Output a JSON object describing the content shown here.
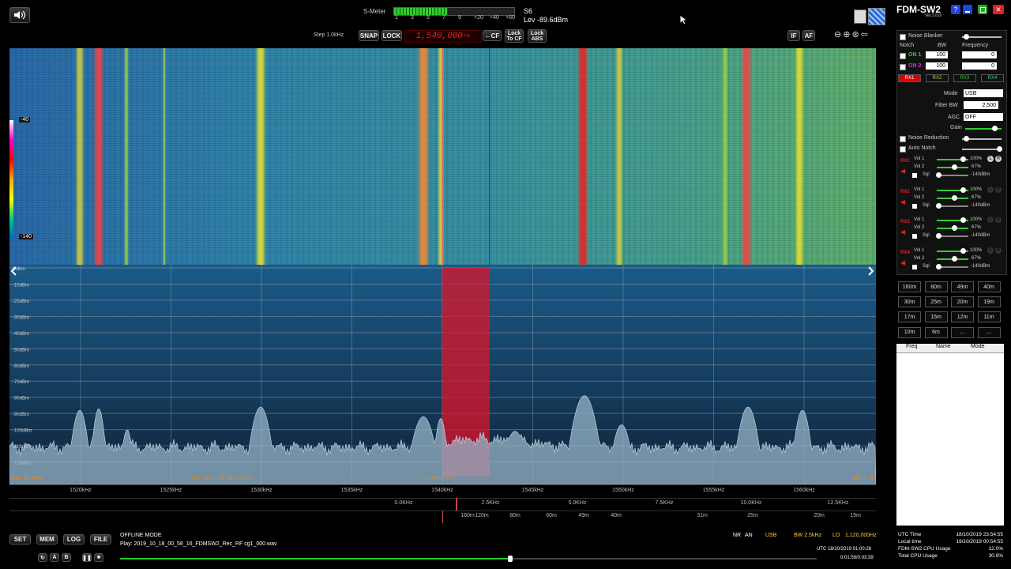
{
  "smeter": {
    "label": "S-Meter",
    "scale": [
      "1",
      "3",
      "5",
      "7",
      "9",
      "+20",
      "+40",
      "+60"
    ],
    "value": "S6",
    "level": "Lev -89.6dBm",
    "fill_fraction": 0.45
  },
  "toolbar": {
    "step": "Step 1.0kHz",
    "snap": "SNAP",
    "lock": "LOCK",
    "frequency": "1,540,000",
    "freq_unit": "Hz",
    "cf": "CF",
    "lock_to_cf": [
      "Lock",
      "To CF"
    ],
    "lock_abs": [
      "Lock",
      "ABS"
    ],
    "if": "IF",
    "af": "AF"
  },
  "waterfall": {
    "level_top": "-40",
    "level_bottom": "-140"
  },
  "spectrum": {
    "db_labels": [
      "0dBm",
      "-10dBm",
      "-20dBm",
      "-30dBm",
      "-40dBm",
      "-50dBm",
      "-60dBm",
      "-70dBm",
      "-80dBm",
      "-90dBm",
      "-100dBm",
      "-110dBm",
      "-120dBm"
    ],
    "span": "Span 48.0kHz",
    "fft_res": "FFT Res. 93.8Hz/point",
    "div": "5.0kHz/div",
    "avg": "AVG = 8",
    "freq_ticks": [
      "1520kHz",
      "1525kHz",
      "1530kHz",
      "1535kHz",
      "1540kHz",
      "1545kHz",
      "1550kHz",
      "1555kHz",
      "1560kHz"
    ],
    "if_ticks": [
      "0.0KHz",
      "2.5KHz",
      "5.0KHz",
      "7.5KHz",
      "10.0KHz",
      "12.5KHz"
    ],
    "meter_ticks": [
      "160m",
      "120m",
      "80m",
      "60m",
      "49m",
      "40m",
      "31m",
      "25m",
      "20m",
      "19m"
    ]
  },
  "status": {
    "set": "SET",
    "mem": "MEM",
    "log": "LOG",
    "file": "FILE",
    "mode_line": "OFFLINE MODE",
    "play_line": "Play: 2019_10_18_00_58_16_FDMSW2_Rec_RF cg1_000.wav",
    "nr": "NR",
    "an": "AN",
    "mode": "USB",
    "bw": "BW 2.5kHz",
    "lo": "LO",
    "lo_freq": "1,120,000Hz",
    "utc": "UTC 18/10/2019 01:00:26",
    "elapsed": "0:01:59/0:03:39",
    "progress": 0.56
  },
  "app": {
    "title": "FDM-SW2",
    "version": "Ver.3.019"
  },
  "panel": {
    "noise_blanker": "Noise Blanker",
    "notch": "Notch",
    "bw": "BW",
    "frequency": "Frequency",
    "notch_rows": [
      {
        "label": "ON 1",
        "bw": "100",
        "freq": "0"
      },
      {
        "label": "ON 2",
        "bw": "100",
        "freq": "0"
      }
    ],
    "rx_buttons": [
      "RX1",
      "RX2",
      "RX3",
      "RX4"
    ],
    "mode_label": "Mode",
    "mode": "USB",
    "filter_label": "Filter BW",
    "filter": "2,500",
    "agc_label": "AGC",
    "agc": "OFF",
    "gain_label": "Gain",
    "noise_reduction": "Noise Reduction",
    "auto_notch": "Auto Notch",
    "receivers": [
      {
        "name": "RX1",
        "vol1": "100%",
        "vol2": "67%",
        "sql": "-140dBm"
      },
      {
        "name": "RX2",
        "vol1": "100%",
        "vol2": "67%",
        "sql": "-140dBm"
      },
      {
        "name": "RX3",
        "vol1": "100%",
        "vol2": "67%",
        "sql": "-140dBm"
      },
      {
        "name": "RX4",
        "vol1": "100%",
        "vol2": "67%",
        "sql": "-140dBm"
      }
    ],
    "vol1_label": "Vol 1",
    "vol2_label": "Vol 2",
    "sql_label": "Sql",
    "bands": [
      "160m",
      "80m",
      "49m",
      "40m",
      "30m",
      "25m",
      "20m",
      "19m",
      "17m",
      "15m",
      "12m",
      "11m",
      "10m",
      "6m",
      "...",
      "..."
    ],
    "mem_headers": [
      "Freq",
      "Name",
      "Mode"
    ],
    "info": [
      {
        "k": "UTC Time",
        "v": "18/10/2019 23:54:55"
      },
      {
        "k": "Local time",
        "v": "19/10/2019 00:54:55"
      },
      {
        "k": "FDM-SW2 CPU Usage",
        "v": "12.0%"
      },
      {
        "k": "Total CPU Usage",
        "v": "30.9%"
      }
    ]
  }
}
